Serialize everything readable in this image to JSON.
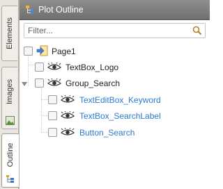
{
  "side_tabs": [
    {
      "label": "Elements"
    },
    {
      "label": "Images"
    },
    {
      "label": "Outline"
    }
  ],
  "panel": {
    "title": "Plot Outline"
  },
  "filter": {
    "placeholder": "Filter...",
    "value": ""
  },
  "tree": {
    "page": {
      "label": "Page1"
    },
    "logo": {
      "label": "TextBox_Logo"
    },
    "group": {
      "label": "Group_Search"
    },
    "keyword": {
      "label": "TextEditBox_Keyword"
    },
    "search_label": {
      "label": "TextBox_SearchLabel"
    },
    "search_button": {
      "label": "Button_Search"
    }
  },
  "colors": {
    "header_bg": "#7f7f7f",
    "selected_label": "#2b7ad1"
  }
}
